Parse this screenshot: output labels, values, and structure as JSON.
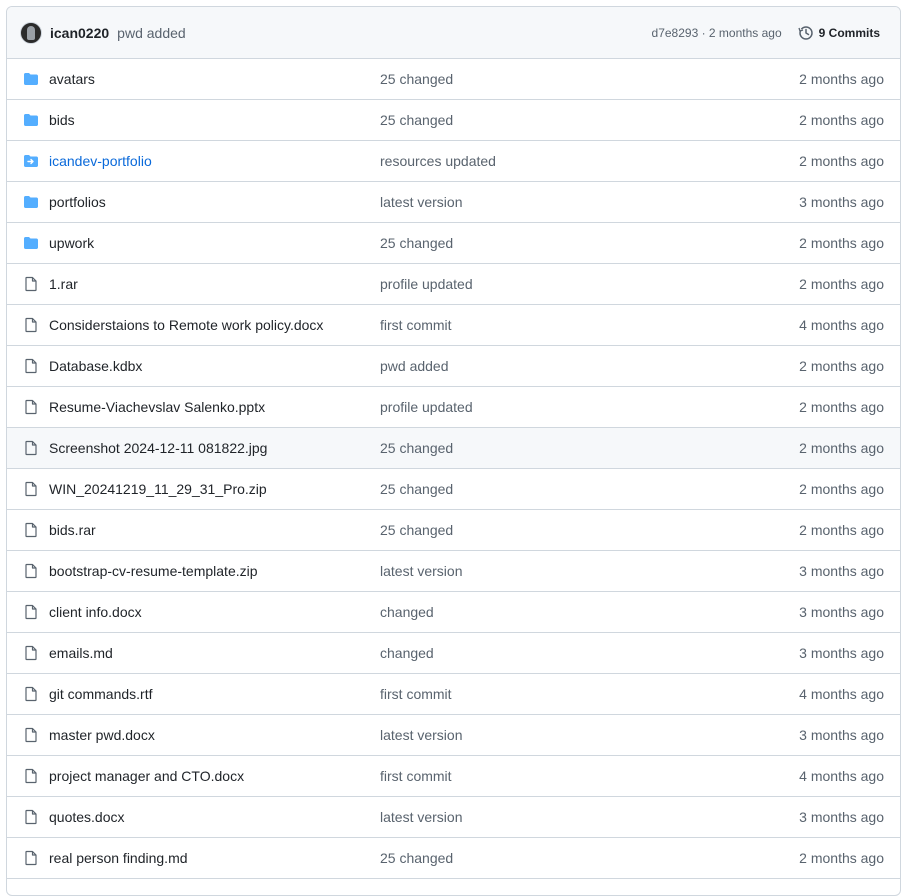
{
  "header": {
    "author": "ican0220",
    "message": "pwd added",
    "meta": "d7e8293 · 2 months ago",
    "commits_label": "9 Commits"
  },
  "colors": {
    "folder": "#54aeff",
    "link": "#0969da",
    "muted": "#59636e"
  },
  "rows": [
    {
      "type": "folder",
      "name": "avatars",
      "message": "25 changed",
      "date": "2 months ago"
    },
    {
      "type": "folder",
      "name": "bids",
      "message": "25 changed",
      "date": "2 months ago"
    },
    {
      "type": "submodule",
      "name": "icandev-portfolio",
      "message": "resources updated",
      "date": "2 months ago"
    },
    {
      "type": "folder",
      "name": "portfolios",
      "message": "latest version",
      "date": "3 months ago"
    },
    {
      "type": "folder",
      "name": "upwork",
      "message": "25 changed",
      "date": "2 months ago"
    },
    {
      "type": "file",
      "name": "1.rar",
      "message": "profile updated",
      "date": "2 months ago"
    },
    {
      "type": "file",
      "name": "Considerstaions to Remote work policy.docx",
      "message": "first commit",
      "date": "4 months ago"
    },
    {
      "type": "file",
      "name": "Database.kdbx",
      "message": "pwd added",
      "date": "2 months ago"
    },
    {
      "type": "file",
      "name": "Resume-Viachevslav Salenko.pptx",
      "message": "profile updated",
      "date": "2 months ago"
    },
    {
      "type": "file",
      "name": "Screenshot 2024-12-11 081822.jpg",
      "message": "25 changed",
      "date": "2 months ago",
      "hover": true
    },
    {
      "type": "file",
      "name": "WIN_20241219_11_29_31_Pro.zip",
      "message": "25 changed",
      "date": "2 months ago"
    },
    {
      "type": "file",
      "name": "bids.rar",
      "message": "25 changed",
      "date": "2 months ago"
    },
    {
      "type": "file",
      "name": "bootstrap-cv-resume-template.zip",
      "message": "latest version",
      "date": "3 months ago"
    },
    {
      "type": "file",
      "name": "client info.docx",
      "message": "changed",
      "date": "3 months ago"
    },
    {
      "type": "file",
      "name": "emails.md",
      "message": "changed",
      "date": "3 months ago"
    },
    {
      "type": "file",
      "name": "git commands.rtf",
      "message": "first commit",
      "date": "4 months ago"
    },
    {
      "type": "file",
      "name": "master pwd.docx",
      "message": "latest version",
      "date": "3 months ago"
    },
    {
      "type": "file",
      "name": "project manager and CTO.docx",
      "message": "first commit",
      "date": "4 months ago"
    },
    {
      "type": "file",
      "name": "quotes.docx",
      "message": "latest version",
      "date": "3 months ago"
    },
    {
      "type": "file",
      "name": "real person finding.md",
      "message": "25 changed",
      "date": "2 months ago"
    }
  ]
}
